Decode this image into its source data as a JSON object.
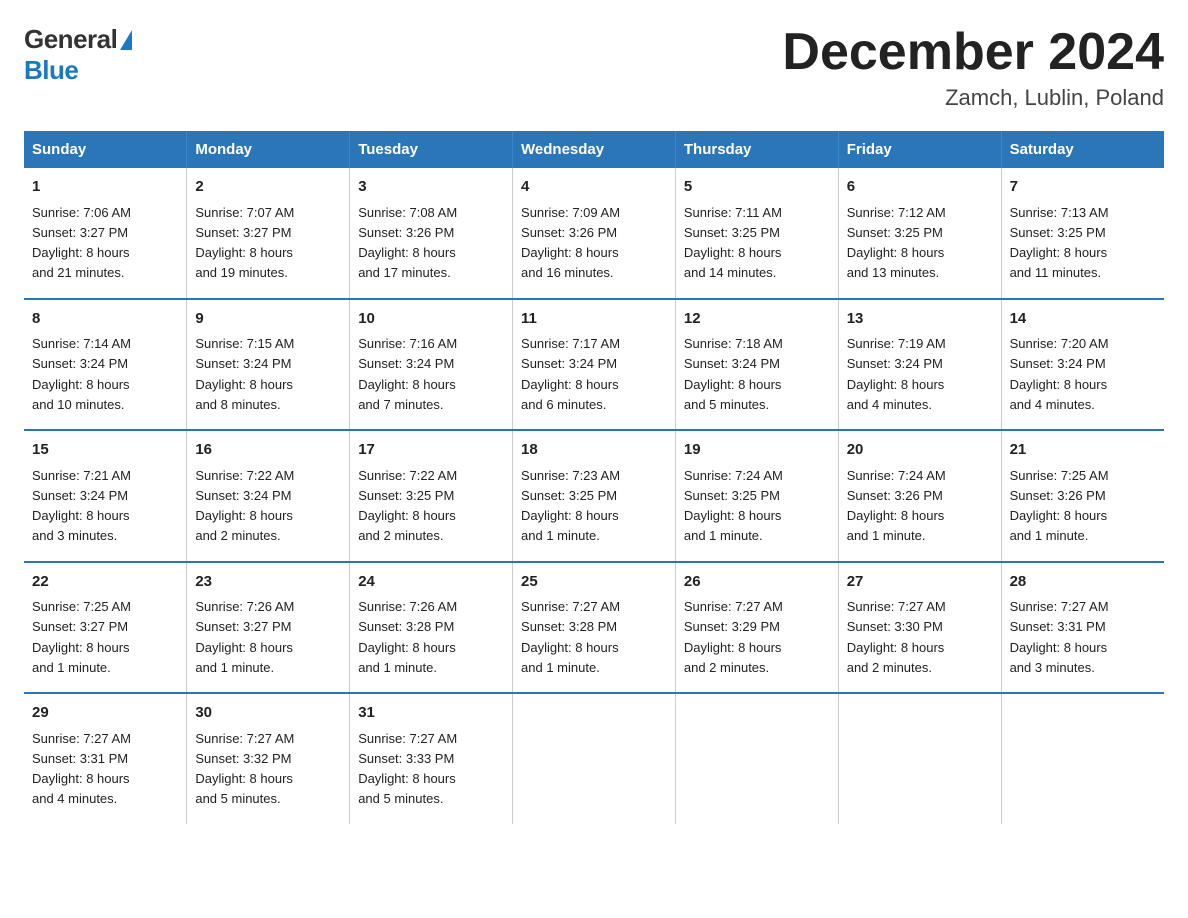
{
  "header": {
    "logo_general": "General",
    "logo_blue": "Blue",
    "title": "December 2024",
    "subtitle": "Zamch, Lublin, Poland"
  },
  "calendar": {
    "days_of_week": [
      "Sunday",
      "Monday",
      "Tuesday",
      "Wednesday",
      "Thursday",
      "Friday",
      "Saturday"
    ],
    "weeks": [
      [
        {
          "day": "1",
          "info": "Sunrise: 7:06 AM\nSunset: 3:27 PM\nDaylight: 8 hours\nand 21 minutes."
        },
        {
          "day": "2",
          "info": "Sunrise: 7:07 AM\nSunset: 3:27 PM\nDaylight: 8 hours\nand 19 minutes."
        },
        {
          "day": "3",
          "info": "Sunrise: 7:08 AM\nSunset: 3:26 PM\nDaylight: 8 hours\nand 17 minutes."
        },
        {
          "day": "4",
          "info": "Sunrise: 7:09 AM\nSunset: 3:26 PM\nDaylight: 8 hours\nand 16 minutes."
        },
        {
          "day": "5",
          "info": "Sunrise: 7:11 AM\nSunset: 3:25 PM\nDaylight: 8 hours\nand 14 minutes."
        },
        {
          "day": "6",
          "info": "Sunrise: 7:12 AM\nSunset: 3:25 PM\nDaylight: 8 hours\nand 13 minutes."
        },
        {
          "day": "7",
          "info": "Sunrise: 7:13 AM\nSunset: 3:25 PM\nDaylight: 8 hours\nand 11 minutes."
        }
      ],
      [
        {
          "day": "8",
          "info": "Sunrise: 7:14 AM\nSunset: 3:24 PM\nDaylight: 8 hours\nand 10 minutes."
        },
        {
          "day": "9",
          "info": "Sunrise: 7:15 AM\nSunset: 3:24 PM\nDaylight: 8 hours\nand 8 minutes."
        },
        {
          "day": "10",
          "info": "Sunrise: 7:16 AM\nSunset: 3:24 PM\nDaylight: 8 hours\nand 7 minutes."
        },
        {
          "day": "11",
          "info": "Sunrise: 7:17 AM\nSunset: 3:24 PM\nDaylight: 8 hours\nand 6 minutes."
        },
        {
          "day": "12",
          "info": "Sunrise: 7:18 AM\nSunset: 3:24 PM\nDaylight: 8 hours\nand 5 minutes."
        },
        {
          "day": "13",
          "info": "Sunrise: 7:19 AM\nSunset: 3:24 PM\nDaylight: 8 hours\nand 4 minutes."
        },
        {
          "day": "14",
          "info": "Sunrise: 7:20 AM\nSunset: 3:24 PM\nDaylight: 8 hours\nand 4 minutes."
        }
      ],
      [
        {
          "day": "15",
          "info": "Sunrise: 7:21 AM\nSunset: 3:24 PM\nDaylight: 8 hours\nand 3 minutes."
        },
        {
          "day": "16",
          "info": "Sunrise: 7:22 AM\nSunset: 3:24 PM\nDaylight: 8 hours\nand 2 minutes."
        },
        {
          "day": "17",
          "info": "Sunrise: 7:22 AM\nSunset: 3:25 PM\nDaylight: 8 hours\nand 2 minutes."
        },
        {
          "day": "18",
          "info": "Sunrise: 7:23 AM\nSunset: 3:25 PM\nDaylight: 8 hours\nand 1 minute."
        },
        {
          "day": "19",
          "info": "Sunrise: 7:24 AM\nSunset: 3:25 PM\nDaylight: 8 hours\nand 1 minute."
        },
        {
          "day": "20",
          "info": "Sunrise: 7:24 AM\nSunset: 3:26 PM\nDaylight: 8 hours\nand 1 minute."
        },
        {
          "day": "21",
          "info": "Sunrise: 7:25 AM\nSunset: 3:26 PM\nDaylight: 8 hours\nand 1 minute."
        }
      ],
      [
        {
          "day": "22",
          "info": "Sunrise: 7:25 AM\nSunset: 3:27 PM\nDaylight: 8 hours\nand 1 minute."
        },
        {
          "day": "23",
          "info": "Sunrise: 7:26 AM\nSunset: 3:27 PM\nDaylight: 8 hours\nand 1 minute."
        },
        {
          "day": "24",
          "info": "Sunrise: 7:26 AM\nSunset: 3:28 PM\nDaylight: 8 hours\nand 1 minute."
        },
        {
          "day": "25",
          "info": "Sunrise: 7:27 AM\nSunset: 3:28 PM\nDaylight: 8 hours\nand 1 minute."
        },
        {
          "day": "26",
          "info": "Sunrise: 7:27 AM\nSunset: 3:29 PM\nDaylight: 8 hours\nand 2 minutes."
        },
        {
          "day": "27",
          "info": "Sunrise: 7:27 AM\nSunset: 3:30 PM\nDaylight: 8 hours\nand 2 minutes."
        },
        {
          "day": "28",
          "info": "Sunrise: 7:27 AM\nSunset: 3:31 PM\nDaylight: 8 hours\nand 3 minutes."
        }
      ],
      [
        {
          "day": "29",
          "info": "Sunrise: 7:27 AM\nSunset: 3:31 PM\nDaylight: 8 hours\nand 4 minutes."
        },
        {
          "day": "30",
          "info": "Sunrise: 7:27 AM\nSunset: 3:32 PM\nDaylight: 8 hours\nand 5 minutes."
        },
        {
          "day": "31",
          "info": "Sunrise: 7:27 AM\nSunset: 3:33 PM\nDaylight: 8 hours\nand 5 minutes."
        },
        {
          "day": "",
          "info": ""
        },
        {
          "day": "",
          "info": ""
        },
        {
          "day": "",
          "info": ""
        },
        {
          "day": "",
          "info": ""
        }
      ]
    ]
  }
}
